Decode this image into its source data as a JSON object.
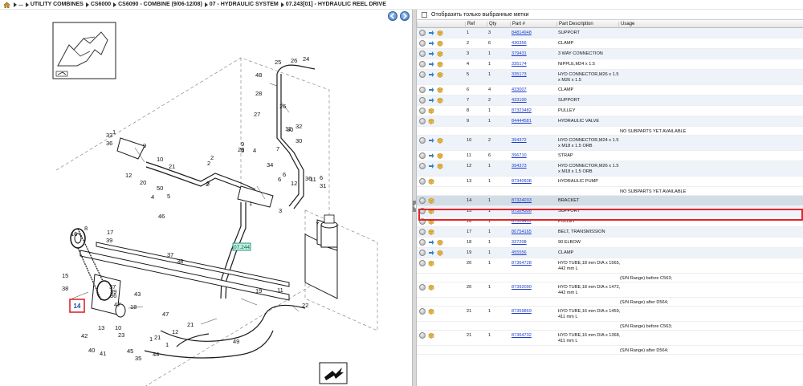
{
  "breadcrumb": {
    "items": [
      "...",
      "UTILITY COMBINES",
      "CS6000",
      "CS6090 - COMBINE (9/06-12/08)",
      "07 - HYDRAULIC SYSTEM",
      "07.243[01] - HYDRAULIC REEL DRIVE"
    ]
  },
  "diagram": {
    "callout_labels": [
      "1",
      "2",
      "3",
      "4",
      "5",
      "6",
      "7",
      "8",
      "9",
      "10",
      "11",
      "12",
      "13",
      "14",
      "15",
      "16",
      "17",
      "18",
      "19",
      "20",
      "21",
      "22",
      "23",
      "24",
      "25",
      "26",
      "27",
      "28",
      "29",
      "30",
      "31",
      "32",
      "33",
      "34",
      "35",
      "36",
      "37",
      "38",
      "39",
      "40",
      "41",
      "42",
      "43",
      "44",
      "45",
      "46",
      "47",
      "48",
      "49",
      "50"
    ],
    "ref_tag": "07.244",
    "highlight_tag": "14"
  },
  "parts": {
    "filter_label": "Отобразить только выбранные метки",
    "columns": [
      "Ref",
      "Qty",
      "Part #",
      "Part Description",
      "Usage"
    ],
    "rows": [
      {
        "ref": "1",
        "qty": "3",
        "part": "84814948",
        "desc": "SUPPORT",
        "icons": "full"
      },
      {
        "ref": "2",
        "qty": "6",
        "part": "430356",
        "desc": "CLAMP",
        "icons": "full"
      },
      {
        "ref": "3",
        "qty": "1",
        "part": "379431",
        "desc": "3 WAY CONNECTION",
        "icons": "full"
      },
      {
        "ref": "4",
        "qty": "1",
        "part": "335174",
        "desc": "NIPPLE,M24 x 1.5",
        "icons": "full"
      },
      {
        "ref": "5",
        "qty": "1",
        "part": "335173",
        "desc": "HYD CONNECTOR,M26 x 1.5  x M26 x 1.5",
        "icons": "full"
      },
      {
        "ref": "6",
        "qty": "4",
        "part": "433007",
        "desc": "CLAMP",
        "icons": "full"
      },
      {
        "ref": "7",
        "qty": "2",
        "part": "433100",
        "desc": "SUPPORT",
        "icons": "full"
      },
      {
        "ref": "8",
        "qty": "1",
        "part": "87323482",
        "desc": "PULLEY",
        "icons": "box"
      },
      {
        "ref": "9",
        "qty": "1",
        "part": "84444581",
        "desc": "HYDRAULIC VALVE",
        "icons": "box"
      },
      {
        "note": "NO SUBPARTS YET AVAILABLE"
      },
      {
        "ref": "10",
        "qty": "2",
        "part": "394372",
        "desc": "HYD CONNECTOR,M24 x 1.5  x M18 x 1.5 ORB",
        "icons": "full"
      },
      {
        "ref": "11",
        "qty": "6",
        "part": "396710",
        "desc": "STRAP",
        "icons": "full"
      },
      {
        "ref": "12",
        "qty": "1",
        "part": "394373",
        "desc": "HYD CONNECTOR,M26 x 1.5  x M18 x 1.5 ORB",
        "icons": "full"
      },
      {
        "ref": "13",
        "qty": "1",
        "part": "87340938",
        "desc": "HYDRAULIC PUMP",
        "icons": "box"
      },
      {
        "note": "NO SUBPARTS YET AVAILABLE"
      },
      {
        "ref": "14",
        "qty": "1",
        "part": "87324033",
        "desc": "BRACKET",
        "icons": "box",
        "selected": true
      },
      {
        "ref": "15",
        "qty": "1",
        "part": "87324306",
        "desc": "SUPPORT",
        "icons": "box"
      },
      {
        "ref": "16",
        "qty": "1",
        "part": "87324411",
        "desc": "PULLEY",
        "icons": "box"
      },
      {
        "ref": "17",
        "qty": "1",
        "part": "80754165",
        "desc": "BELT, TRANSMISSION",
        "icons": "box"
      },
      {
        "ref": "18",
        "qty": "1",
        "part": "337208",
        "desc": "90 ELBOW",
        "icons": "full"
      },
      {
        "ref": "19",
        "qty": "1",
        "part": "455556",
        "desc": "CLAMP",
        "icons": "full"
      },
      {
        "ref": "20",
        "qty": "1",
        "part": "87364728",
        "desc": "HYD TUBE,18 mm DIA x 1565, 442 mm L",
        "icons": "box"
      },
      {
        "note": "(S/N Range) before C563;"
      },
      {
        "ref": "20",
        "qty": "1",
        "part": "87392090",
        "desc": "HYD TUBE,18 mm DIA x 1472, 442 mm L",
        "icons": "box"
      },
      {
        "note": "(S/N Range) after D564;"
      },
      {
        "ref": "21",
        "qty": "1",
        "part": "87359869",
        "desc": "HYD TUBE,16 mm DIA x 1459, 411 mm L",
        "icons": "box"
      },
      {
        "note": "(S/N Range) before C563;"
      },
      {
        "ref": "21",
        "qty": "1",
        "part": "87364732",
        "desc": "HYD TUBE,16 mm DIA x 1368, 411 mm L",
        "icons": "box"
      },
      {
        "note": "(S/N Range) after D564;"
      }
    ]
  }
}
